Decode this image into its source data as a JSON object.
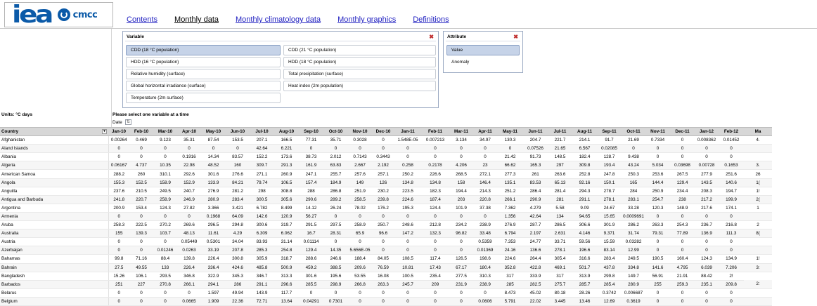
{
  "logo": {
    "primary": "iea",
    "secondary": "cmcc"
  },
  "nav": [
    "Contents",
    "Monthly data",
    "Monthly climatology data",
    "Monthly graphics",
    "Definitions"
  ],
  "variable_panel": {
    "title": "Variable",
    "options": [
      "CDD (18 °C population)",
      "CDD (21 °C population)",
      "HDD (16 °C population)",
      "HDD (18 °C population)",
      "Relative humidity (surface)",
      "Total precipitation (surface)",
      "Global horizontal irradiance (surface)",
      "Heat index (2m population)",
      "Temperature (2m surface)"
    ],
    "selected": "CDD (18 °C population)"
  },
  "attribute_panel": {
    "title": "Attribute",
    "options": [
      "Value",
      "Anomaly"
    ],
    "selected": "Value"
  },
  "units": "Units: °C days",
  "hint": "Please select one variable at a time",
  "date_label": "Date",
  "table": {
    "country_header": "Country",
    "months": [
      "Jan-10",
      "Feb-10",
      "Mar-10",
      "Apr-10",
      "May-10",
      "Jun-10",
      "Jul-10",
      "Aug-10",
      "Sep-10",
      "Oct-10",
      "Nov-10",
      "Dec-10",
      "Jan-11",
      "Feb-11",
      "Mar-11",
      "Apr-11",
      "May-11",
      "Jun-11",
      "Jul-11",
      "Aug-11",
      "Sep-11",
      "Oct-11",
      "Nov-11",
      "Dec-11",
      "Jan-12",
      "Feb-12",
      "Ma"
    ],
    "rows": [
      {
        "country": "Afghanistan",
        "values": [
          "0.00264",
          "0.469",
          "9.123",
          "35.31",
          "87.54",
          "153.5",
          "207.1",
          "166.5",
          "77.31",
          "35.71",
          "0.3028",
          "0",
          "1.548E-05",
          "0.007213",
          "3.134",
          "34.97",
          "130.3",
          "204.7",
          "221.7",
          "214.1",
          "91.7",
          "21.69",
          "0.7334",
          "0",
          "0.008362",
          "0.01452",
          "4."
        ]
      },
      {
        "country": "Aland Islands",
        "values": [
          "0",
          "0",
          "0",
          "0",
          "0",
          "0",
          "42.64",
          "6.221",
          "0",
          "0",
          "0",
          "0",
          "0",
          "0",
          "0",
          "0",
          "0",
          "0.07526",
          "21.65",
          "6.567",
          "0.02085",
          "0",
          "0",
          "0",
          "0",
          "0",
          ""
        ]
      },
      {
        "country": "Albania",
        "values": [
          "0",
          "0",
          "0",
          "0.1916",
          "14.34",
          "83.57",
          "152.2",
          "173.6",
          "38.73",
          "2.012",
          "0.7143",
          "0.3443",
          "0",
          "0",
          "0",
          "0",
          "21.42",
          "91.73",
          "148.5",
          "182.4",
          "128.7",
          "9.438",
          "0",
          "0",
          "0",
          "0",
          ""
        ]
      },
      {
        "country": "Algeria",
        "values": [
          "0.06167",
          "4.737",
          "10.35",
          "22.98",
          "48.52",
          "160",
          "309.7",
          "291.3",
          "161.9",
          "63.83",
          "2.667",
          "2.192",
          "0.258",
          "0.2178",
          "4.206",
          "23",
          "66.62",
          "165.3",
          "297",
          "309.8",
          "193.4",
          "43.24",
          "5.034",
          "0.03698",
          "0.00728",
          "0.1653",
          "3."
        ]
      },
      {
        "country": "American Samoa",
        "values": [
          "288.2",
          "260",
          "310.1",
          "292.6",
          "301.6",
          "276.6",
          "271.1",
          "260.9",
          "247.1",
          "255.7",
          "257.6",
          "257.1",
          "250.2",
          "226.6",
          "268.5",
          "272.1",
          "277.3",
          "261",
          "263.6",
          "252.8",
          "247.8",
          "250.3",
          "253.6",
          "267.5",
          "277.9",
          "251.6",
          "26"
        ]
      },
      {
        "country": "Angola",
        "values": [
          "155.3",
          "152.5",
          "158.9",
          "152.9",
          "133.9",
          "84.21",
          "79.74",
          "106.5",
          "157.4",
          "184.9",
          "149",
          "126",
          "134.8",
          "134.8",
          "158",
          "146.4",
          "135.1",
          "83.53",
          "65.13",
          "92.16",
          "150.1",
          "165",
          "144.4",
          "129.4",
          "143.5",
          "140.6",
          "1("
        ]
      },
      {
        "country": "Anguilla",
        "values": [
          "237.6",
          "210.5",
          "249.5",
          "240.7",
          "276.9",
          "281.2",
          "298",
          "308.8",
          "288",
          "286.8",
          "251.9",
          "230.2",
          "223.5",
          "182.3",
          "194.4",
          "214.3",
          "251.2",
          "286.4",
          "281.4",
          "294.3",
          "278.7",
          "284",
          "250.9",
          "234.4",
          "208.3",
          "194.7",
          "1!"
        ]
      },
      {
        "country": "Antigua and Barbuda",
        "values": [
          "241.8",
          "220.7",
          "258.9",
          "246.9",
          "280.9",
          "283.4",
          "300.5",
          "305.6",
          "290.6",
          "289.2",
          "258.5",
          "239.8",
          "224.6",
          "187.4",
          "203",
          "220.8",
          "266.1",
          "290.9",
          "281",
          "291.1",
          "278.1",
          "283.1",
          "254.7",
          "238",
          "217.2",
          "199.9",
          "2("
        ]
      },
      {
        "country": "Argentina",
        "values": [
          "200.9",
          "153.4",
          "124.3",
          "27.82",
          "3.366",
          "3.421",
          "6.782",
          "8.499",
          "14.12",
          "26.24",
          "78.02",
          "176.2",
          "195.3",
          "124.4",
          "101.9",
          "37.38",
          "7.362",
          "4.279",
          "5.58",
          "9.09",
          "24.67",
          "33.28",
          "120.3",
          "148.9",
          "217.6",
          "174.1",
          "1"
        ]
      },
      {
        "country": "Armenia",
        "values": [
          "0",
          "0",
          "0",
          "0",
          "0.1968",
          "64.09",
          "142.6",
          "120.9",
          "56.27",
          "0",
          "0",
          "0",
          "0",
          "0",
          "0",
          "0",
          "1.356",
          "42.64",
          "134",
          "94.65",
          "15.65",
          "0.0009691",
          "0",
          "0",
          "0",
          "0",
          ""
        ]
      },
      {
        "country": "Aruba",
        "values": [
          "258.3",
          "222.5",
          "270.2",
          "269.6",
          "296.5",
          "294.8",
          "300.6",
          "319.7",
          "291.5",
          "297.5",
          "258.9",
          "250.7",
          "248.6",
          "212.8",
          "234.2",
          "238.9",
          "276.9",
          "287.7",
          "286.5",
          "306.6",
          "301.9",
          "286.2",
          "263.3",
          "254.3",
          "236.7",
          "216.8",
          "2"
        ]
      },
      {
        "country": "Australia",
        "values": [
          "155",
          "139.3",
          "103.7",
          "48.13",
          "11.61",
          "4.29",
          "6.309",
          "6.062",
          "16.7",
          "28.31",
          "65.9",
          "96.6",
          "147.2",
          "132.3",
          "96.82",
          "33.48",
          "6.794",
          "2.197",
          "2.631",
          "4.146",
          "9.371",
          "31.74",
          "79.31",
          "77.89",
          "136.9",
          "111.3",
          "8("
        ]
      },
      {
        "country": "Austria",
        "values": [
          "0",
          "0",
          "0",
          "0.05449",
          "0.5301",
          "34.04",
          "83.93",
          "31.14",
          "0.01114",
          "0",
          "0",
          "0",
          "0",
          "0",
          "0",
          "0.5359",
          "7.353",
          "24.77",
          "33.71",
          "59.56",
          "15.59",
          "0.03282",
          "0",
          "0",
          "0",
          "0",
          ""
        ]
      },
      {
        "country": "Azerbaijan",
        "values": [
          "0",
          "0",
          "0.01246",
          "0.0263",
          "33.19",
          "207.8",
          "285.3",
          "254.8",
          "129.4",
          "14.35",
          "5.656E-05",
          "0",
          "0",
          "0",
          "0",
          "0.01369",
          "24.16",
          "136.6",
          "278.1",
          "196.6",
          "83.14",
          "12.99",
          "0",
          "0",
          "0",
          "0",
          ""
        ]
      },
      {
        "country": "Bahamas",
        "values": [
          "99.8",
          "71.16",
          "88.4",
          "139.8",
          "226.4",
          "300.8",
          "305.9",
          "318.7",
          "288.6",
          "246.6",
          "188.4",
          "84.05",
          "108.5",
          "117.4",
          "126.5",
          "198.6",
          "224.6",
          "264.4",
          "305.4",
          "316.6",
          "283.4",
          "249.5",
          "190.5",
          "160.4",
          "124.3",
          "134.9",
          "1!"
        ]
      },
      {
        "country": "Bahrain",
        "values": [
          "27.5",
          "49.55",
          "133",
          "226.4",
          "336.4",
          "424.6",
          "485.8",
          "500.9",
          "459.2",
          "388.5",
          "209.6",
          "76.59",
          "10.81",
          "17.43",
          "67.17",
          "180.4",
          "352.8",
          "422.8",
          "469.1",
          "501.7",
          "437.8",
          "334.8",
          "141.6",
          "4.795",
          "6.039",
          "7.206",
          "3:"
        ]
      },
      {
        "country": "Bangladesh",
        "values": [
          "15.26",
          "106.1",
          "293.5",
          "346.8",
          "322.9",
          "345.3",
          "346.7",
          "313.3",
          "301.6",
          "195.6",
          "53.55",
          "16.08",
          "100.5",
          "235.4",
          "277.5",
          "310.3",
          "317",
          "333.9",
          "317",
          "313.9",
          "299.8",
          "149.7",
          "56.91",
          "21.91",
          "88.42",
          "2!"
        ]
      },
      {
        "country": "Barbados",
        "values": [
          "251",
          "227",
          "270.8",
          "266.1",
          "294.1",
          "286",
          "291.1",
          "296.6",
          "285.5",
          "298.9",
          "266.8",
          "263.3",
          "245.7",
          "209",
          "231.9",
          "238.9",
          "285",
          "282.5",
          "275.7",
          "285.7",
          "285.4",
          "280.9",
          "255",
          "259.3",
          "235.1",
          "209.8",
          "2:"
        ]
      },
      {
        "country": "Belarus",
        "values": [
          "0",
          "0",
          "0",
          "0",
          "1.597",
          "49.94",
          "143.9",
          "117.7",
          "0",
          "0",
          "0",
          "0",
          "0",
          "0",
          "0",
          "0",
          "8.473",
          "45.02",
          "80.18",
          "28.26",
          "0.3742",
          "0.006687",
          "0",
          "0",
          "0",
          "0",
          ""
        ]
      },
      {
        "country": "Belgium",
        "values": [
          "0",
          "0",
          "0",
          "0.0665",
          "1.909",
          "22.36",
          "72.71",
          "13.64",
          "0.04291",
          "0.7301",
          "0",
          "0",
          "0",
          "0",
          "0",
          "0.0606",
          "5.791",
          "22.02",
          "3.445",
          "13.46",
          "12.69",
          "0.3619",
          "0",
          "0",
          "0",
          "0",
          ""
        ]
      }
    ]
  }
}
